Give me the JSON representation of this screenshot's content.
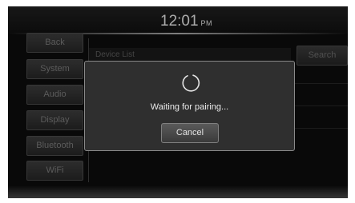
{
  "status_bar": {
    "time": "12:01",
    "ampm": "PM"
  },
  "sidebar": {
    "items": [
      {
        "label": "Back"
      },
      {
        "label": "System"
      },
      {
        "label": "Audio"
      },
      {
        "label": "Display"
      },
      {
        "label": "Bluetooth"
      },
      {
        "label": "WiFi"
      }
    ]
  },
  "device_list": {
    "title": "Device List",
    "search_label": "Search"
  },
  "dialog": {
    "message": "Waiting for pairing...",
    "cancel_label": "Cancel"
  }
}
